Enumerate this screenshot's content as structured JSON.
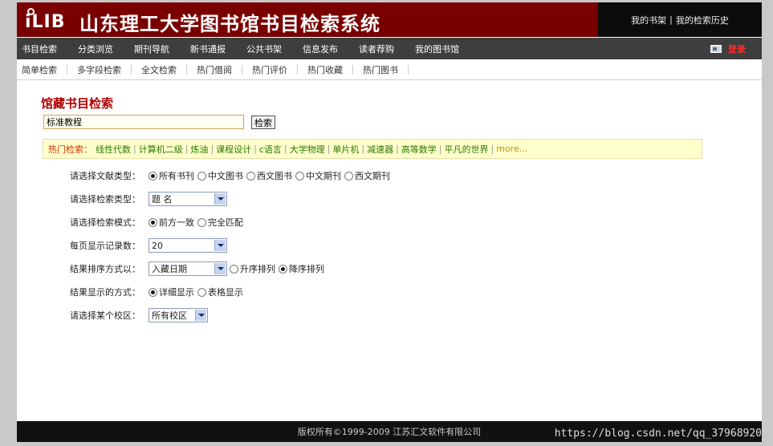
{
  "header": {
    "logo_text": "iLIB",
    "title": "山东理工大学图书馆书目检索系统",
    "my_shelf": "我的书架",
    "separator": "|",
    "history": "我的检索历史"
  },
  "main_nav": {
    "items": [
      "书目检索",
      "分类浏览",
      "期刊导航",
      "新书通报",
      "公共书架",
      "信息发布",
      "读者荐购",
      "我的图书馆"
    ],
    "login_label": "登录"
  },
  "sub_nav": {
    "items": [
      "简单检索",
      "多字段检索",
      "全文检索",
      "热门借阅",
      "热门评价",
      "热门收藏",
      "热门图书"
    ]
  },
  "search": {
    "section_title": "馆藏书目检索",
    "query_value": "标准教程",
    "button_label": "检索"
  },
  "hot": {
    "label": "热门检索：",
    "items": [
      "线性代数",
      "计算机二级",
      "炼油",
      "课程设计",
      "c语言",
      "大学物理",
      "单片机",
      "减速器",
      "高等数学",
      "平凡的世界"
    ],
    "more": "more..."
  },
  "form": {
    "doc_type": {
      "label": "请选择文献类型：",
      "options": [
        "所有书刊",
        "中文图书",
        "西文图书",
        "中文期刊",
        "西文期刊"
      ],
      "selected": "所有书刊"
    },
    "search_type": {
      "label": "请选择检索类型：",
      "value": "题  名"
    },
    "search_mode": {
      "label": "请选择检索模式：",
      "options": [
        "前方一致",
        "完全匹配"
      ],
      "selected": "前方一致"
    },
    "page_size": {
      "label": "每页显示记录数：",
      "value": "20"
    },
    "sort": {
      "label": "结果排序方式以：",
      "value": "入藏日期",
      "order_options": [
        "升序排列",
        "降序排列"
      ],
      "selected_order": "降序排列"
    },
    "display": {
      "label": "结果显示的方式：",
      "options": [
        "详细显示",
        "表格显示"
      ],
      "selected": "详细显示"
    },
    "campus": {
      "label": "请选择某个校区：",
      "value": "所有校区"
    }
  },
  "footer": {
    "copyright": "版权所有©1999-2009 江苏汇文软件有限公司"
  },
  "watermark": "https://blog.csdn.net/qq_37968920"
}
